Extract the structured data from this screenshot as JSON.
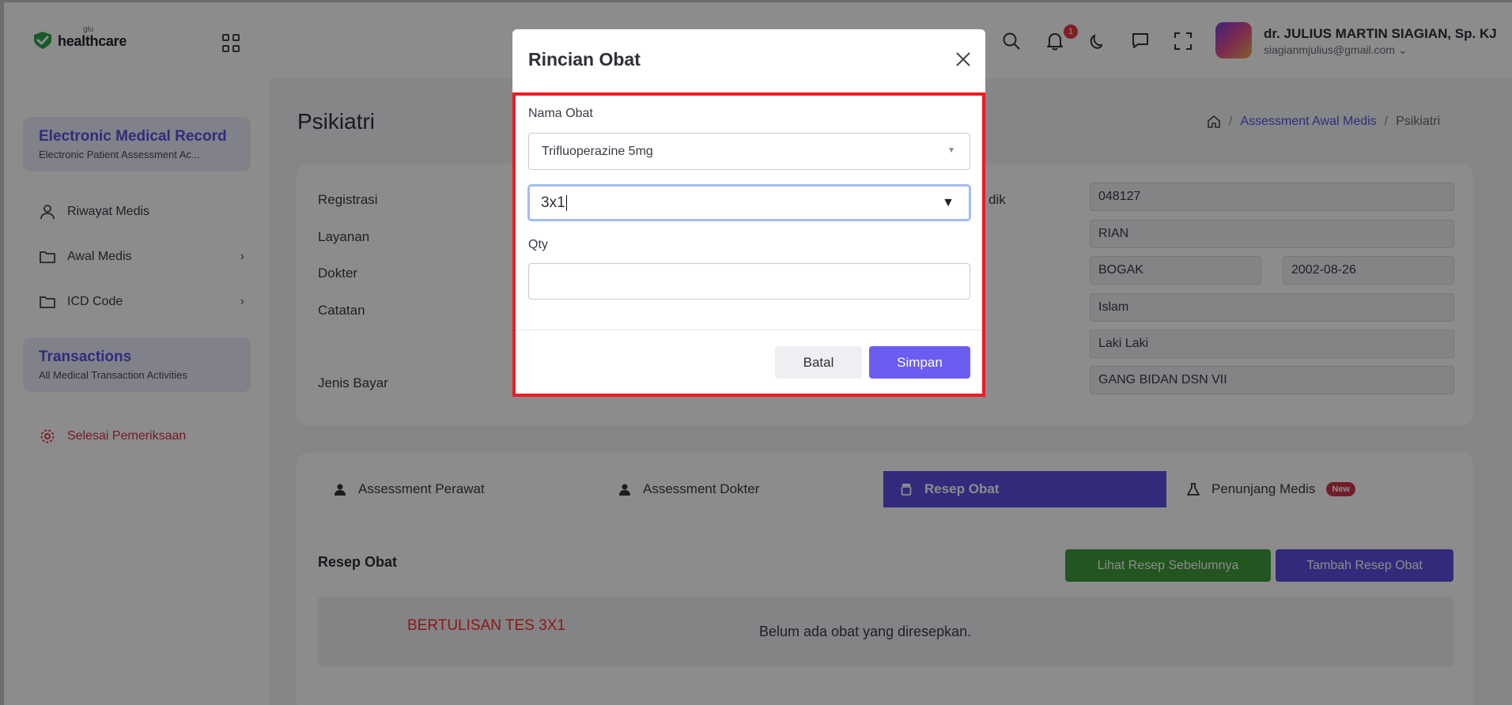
{
  "app": {
    "logo_small": "glu",
    "logo_word": "healthcare"
  },
  "sidebar": {
    "cards": [
      {
        "title": "Electronic Medical Record",
        "subtitle": "Electronic Patient Assessment Ac..."
      },
      {
        "title": "Transactions",
        "subtitle": "All Medical Transaction Activities"
      }
    ],
    "items": [
      {
        "label": "Riwayat Medis",
        "icon": "user-icon"
      },
      {
        "label": "Awal Medis",
        "icon": "folder-icon"
      },
      {
        "label": "ICD Code",
        "icon": "folder-icon"
      }
    ],
    "finish_label": "Selesai Pemeriksaan"
  },
  "topbar": {
    "notification_count": "1",
    "user_name": "dr. JULIUS MARTIN SIAGIAN, Sp. KJ",
    "user_email": "siagianmjulius@gmail.com"
  },
  "page": {
    "title": "Psikiatri",
    "breadcrumb": [
      "Assessment Awal Medis",
      "Psikiatri"
    ]
  },
  "patient": {
    "labels": [
      "Registrasi",
      "Layanan",
      "Dokter",
      "Catatan",
      "Jenis Bayar"
    ],
    "right_label_fragment": "dik",
    "values": {
      "record_no": "048127",
      "name": "RIAN",
      "birth_place": "BOGAK",
      "birth_date": "2002-08-26",
      "religion": "Islam",
      "gender": "Laki Laki",
      "address": "GANG BIDAN DSN VII"
    }
  },
  "tabs": [
    {
      "label": "Assessment Perawat"
    },
    {
      "label": "Assessment Dokter"
    },
    {
      "label": "Resep Obat"
    },
    {
      "label": "Penunjang Medis",
      "badge": "New"
    }
  ],
  "resep": {
    "title": "Resep Obat",
    "btn_prev": "Lihat Resep Sebelumnya",
    "btn_add": "Tambah Resep Obat",
    "empty": "Belum ada obat yang diresepkan.",
    "annotation": "BERTULISAN TES 3X1"
  },
  "modal": {
    "title": "Rincian Obat",
    "nama_obat_label": "Nama Obat",
    "nama_obat_value": "Trifluoperazine 5mg",
    "dosage_value": "3x1",
    "qty_label": "Qty",
    "qty_value": "",
    "cancel_label": "Batal",
    "save_label": "Simpan"
  },
  "colors": {
    "accent": "#5b4fe0",
    "green": "#3e9b3a",
    "danger": "#d0334a",
    "highlight": "#ee1c24"
  }
}
